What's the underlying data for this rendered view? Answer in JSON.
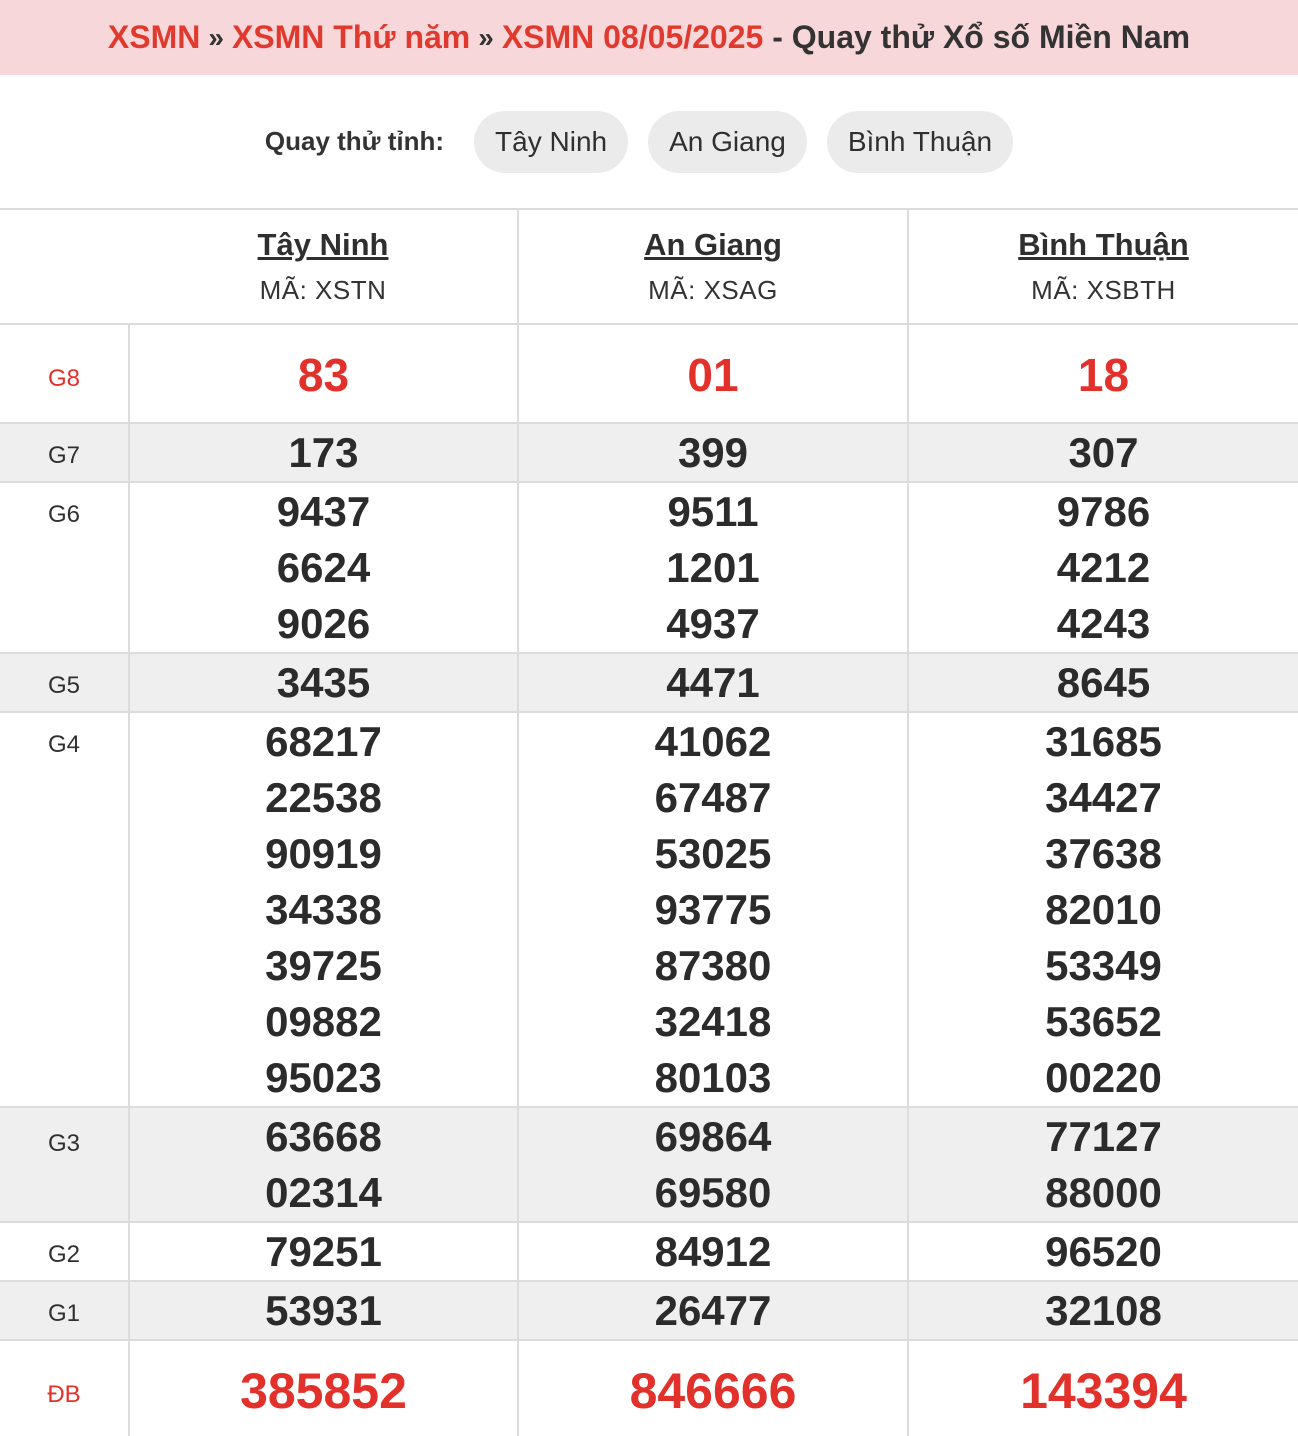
{
  "breadcrumb": {
    "item1": "XSMN",
    "item2": "XSMN Thứ năm",
    "item3": "XSMN 08/05/2025",
    "separator": "»",
    "tail": "- Quay thử Xổ số Miền Nam"
  },
  "quick": {
    "label": "Quay thử tỉnh:",
    "buttons": [
      "Tây Ninh",
      "An Giang",
      "Bình Thuận"
    ]
  },
  "provinces": [
    {
      "name": "Tây Ninh",
      "code": "MÃ: XSTN"
    },
    {
      "name": "An Giang",
      "code": "MÃ: XSAG"
    },
    {
      "name": "Bình Thuận",
      "code": "MÃ: XSBTH"
    }
  ],
  "prizes": [
    {
      "label": "G8",
      "values": [
        [
          "83"
        ],
        [
          "01"
        ],
        [
          "18"
        ]
      ]
    },
    {
      "label": "G7",
      "values": [
        [
          "173"
        ],
        [
          "399"
        ],
        [
          "307"
        ]
      ]
    },
    {
      "label": "G6",
      "values": [
        [
          "9437",
          "6624",
          "9026"
        ],
        [
          "9511",
          "1201",
          "4937"
        ],
        [
          "9786",
          "4212",
          "4243"
        ]
      ]
    },
    {
      "label": "G5",
      "values": [
        [
          "3435"
        ],
        [
          "4471"
        ],
        [
          "8645"
        ]
      ]
    },
    {
      "label": "G4",
      "values": [
        [
          "68217",
          "22538",
          "90919",
          "34338",
          "39725",
          "09882",
          "95023"
        ],
        [
          "41062",
          "67487",
          "53025",
          "93775",
          "87380",
          "32418",
          "80103"
        ],
        [
          "31685",
          "34427",
          "37638",
          "82010",
          "53349",
          "53652",
          "00220"
        ]
      ]
    },
    {
      "label": "G3",
      "values": [
        [
          "63668",
          "02314"
        ],
        [
          "69864",
          "69580"
        ],
        [
          "77127",
          "88000"
        ]
      ]
    },
    {
      "label": "G2",
      "values": [
        [
          "79251"
        ],
        [
          "84912"
        ],
        [
          "96520"
        ]
      ]
    },
    {
      "label": "G1",
      "values": [
        [
          "53931"
        ],
        [
          "26477"
        ],
        [
          "32108"
        ]
      ]
    },
    {
      "label": "ĐB",
      "values": [
        [
          "385852"
        ],
        [
          "846666"
        ],
        [
          "143394"
        ]
      ]
    }
  ],
  "colors": {
    "accent": "#e2302b",
    "header_bg": "#f7d7d9",
    "row_alt": "#efefef"
  }
}
